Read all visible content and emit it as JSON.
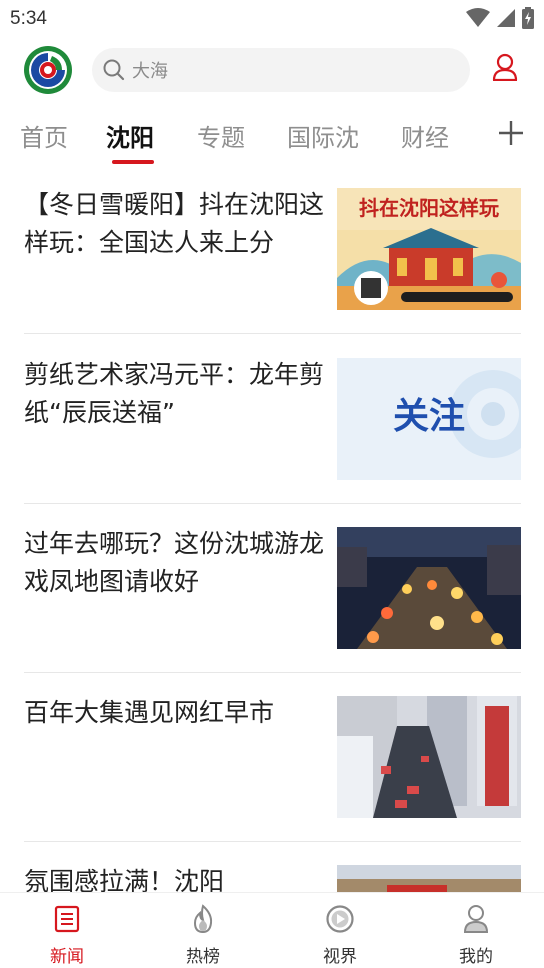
{
  "status_bar": {
    "time": "5:34"
  },
  "search": {
    "placeholder": "大海"
  },
  "tabs": [
    {
      "label": "首页"
    },
    {
      "label": "沈阳"
    },
    {
      "label": "专题"
    },
    {
      "label": "国际沈"
    },
    {
      "label": "财经"
    }
  ],
  "active_tab": "沈阳",
  "news": [
    {
      "title": "【冬日雪暖阳】抖在沈阳这样玩：全国达人来上分",
      "thumb_text": "抖在沈阳这样玩"
    },
    {
      "title": "剪纸艺术家冯元平：龙年剪纸“辰辰送福”",
      "thumb_text": "关注"
    },
    {
      "title": "过年去哪玩？这份沈城游龙戏凤地图请收好"
    },
    {
      "title": "百年大集遇见网红早市"
    },
    {
      "title": "氛围感拉满！沈阳"
    }
  ],
  "bottom_nav": [
    {
      "label": "新闻",
      "icon": "news-icon"
    },
    {
      "label": "热榜",
      "icon": "flame-icon"
    },
    {
      "label": "视界",
      "icon": "play-icon"
    },
    {
      "label": "我的",
      "icon": "user-icon"
    }
  ],
  "colors": {
    "accent": "#d6171e",
    "logo_green": "#1f8a3a",
    "logo_blue": "#1b4aa3"
  }
}
